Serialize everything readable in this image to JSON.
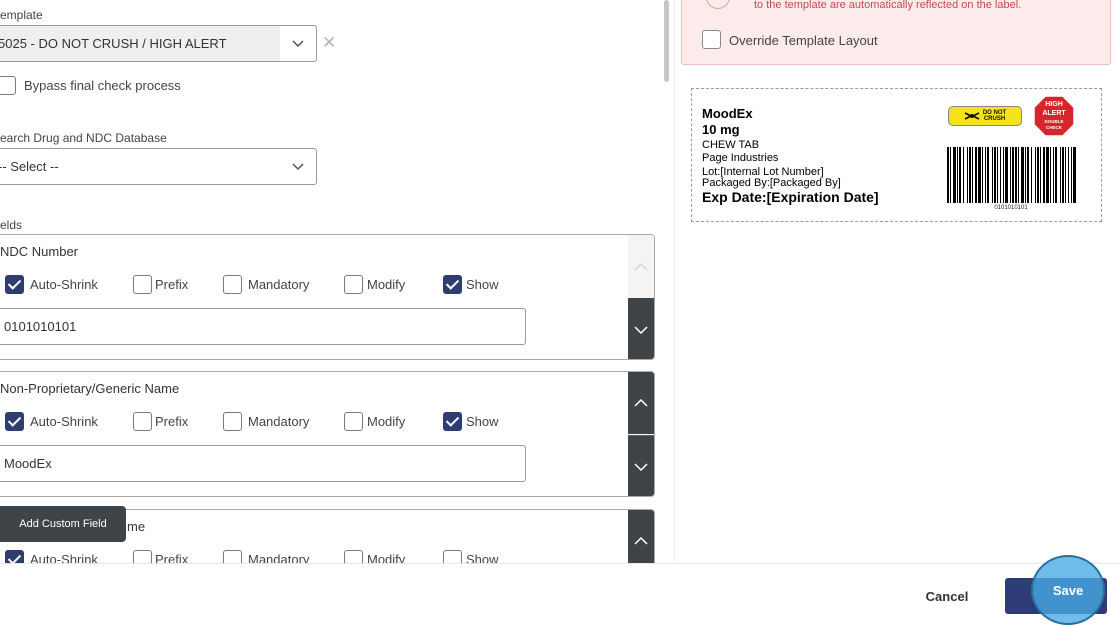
{
  "template": {
    "label": "emplate",
    "value": "5025 - DO NOT CRUSH / HIGH ALERT"
  },
  "bypass": {
    "label": "Bypass final check process",
    "checked": false
  },
  "search": {
    "label": "earch Drug and NDC Database",
    "value": "-- Select --"
  },
  "fields_label": "elds",
  "checkbox_labels": {
    "auto_shrink": "Auto-Shrink",
    "prefix": "Prefix",
    "mandatory": "Mandatory",
    "modify": "Modify",
    "show": "Show"
  },
  "fields": [
    {
      "title": "NDC Number",
      "value": "0101010101",
      "auto_shrink": true,
      "prefix": false,
      "mandatory": false,
      "modify": false,
      "show": true
    },
    {
      "title": "Non-Proprietary/Generic Name",
      "value": "MoodEx",
      "auto_shrink": true,
      "prefix": false,
      "mandatory": false,
      "modify": false,
      "show": true
    },
    {
      "title": "me",
      "auto_shrink": true,
      "prefix": false,
      "mandatory": false,
      "modify": false,
      "show": false
    }
  ],
  "add_custom_field": "Add Custom Field",
  "alert": {
    "text": "to the template are automatically reflected on the label."
  },
  "override": {
    "label": "Override Template Layout",
    "checked": false
  },
  "label_preview": {
    "drug_name": "MoodEx",
    "strength": "10 mg",
    "form": "CHEW TAB",
    "manufacturer": "Page Industries",
    "lot": "Lot:[Internal Lot Number]",
    "packaged_by": "Packaged By:[Packaged By]",
    "exp_date": "Exp Date:[Expiration Date]",
    "barcode_number": "0101010101",
    "do_not_crush_line1": "DO NOT",
    "do_not_crush_line2": "CRUSH",
    "high_alert_line1": "HIGH",
    "high_alert_line2": "ALERT",
    "high_alert_line3": "DOUBLE",
    "high_alert_line4": "CHECK"
  },
  "footer": {
    "cancel": "Cancel",
    "save": "Save"
  },
  "colors": {
    "primary": "#2e3c78",
    "checked": "#2e3c70",
    "alert_bg": "#fcebeb",
    "alert_text": "#c74a4a",
    "dark_btn": "#3f4449",
    "highlight": "#46aae6"
  }
}
